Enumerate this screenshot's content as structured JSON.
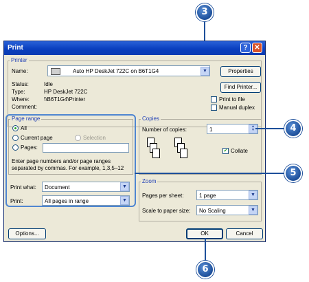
{
  "window": {
    "title": "Print",
    "help_glyph": "?",
    "close_glyph": "✕"
  },
  "printer": {
    "group_label": "Printer",
    "name_label": "Name:",
    "name_value": "Auto HP DeskJet 722C on B6T1G4",
    "properties_button": "Properties",
    "find_printer_button": "Find Printer...",
    "status_label": "Status:",
    "status_value": "Idle",
    "type_label": "Type:",
    "type_value": "HP DeskJet 722C",
    "where_label": "Where:",
    "where_value": "\\\\B6T1G4\\Printer",
    "comment_label": "Comment:",
    "print_to_file": "Print to file",
    "manual_duplex": "Manual duplex"
  },
  "page_range": {
    "group_label": "Page range",
    "all": "All",
    "current_page": "Current page",
    "selection": "Selection",
    "pages": "Pages:",
    "hint": "Enter page numbers and/or page ranges separated by commas.  For example, 1,3,5–12"
  },
  "print_what": {
    "label": "Print what:",
    "value": "Document"
  },
  "print": {
    "label": "Print:",
    "value": "All pages in range"
  },
  "copies": {
    "group_label": "Copies",
    "number_label": "Number of copies:",
    "number_value": "1",
    "collate": "Collate"
  },
  "zoom": {
    "group_label": "Zoom",
    "pages_per_sheet_label": "Pages per sheet:",
    "pages_per_sheet_value": "1 page",
    "scale_label": "Scale to paper size:",
    "scale_value": "No Scaling"
  },
  "buttons": {
    "options": "Options...",
    "ok": "OK",
    "cancel": "Cancel"
  },
  "callouts": {
    "c3": "3",
    "c4": "4",
    "c5": "5",
    "c6": "6"
  },
  "icons": {
    "dropdown": "dropdown-arrow-icon",
    "spin": "spinner-icon",
    "printer": "printer-icon"
  }
}
